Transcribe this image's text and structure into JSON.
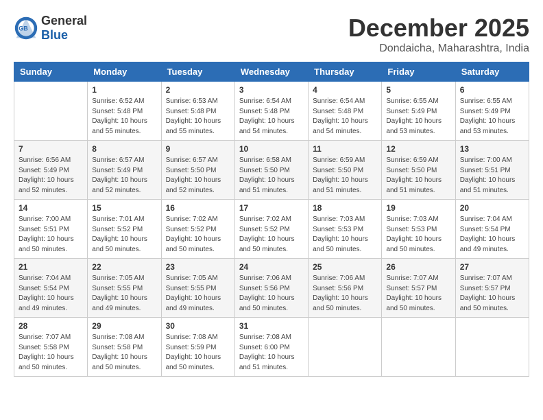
{
  "header": {
    "logo_general": "General",
    "logo_blue": "Blue",
    "month_title": "December 2025",
    "location": "Dondaicha, Maharashtra, India"
  },
  "days_of_week": [
    "Sunday",
    "Monday",
    "Tuesday",
    "Wednesday",
    "Thursday",
    "Friday",
    "Saturday"
  ],
  "weeks": [
    [
      {
        "day": null
      },
      {
        "day": 1,
        "sunrise": "6:52 AM",
        "sunset": "5:48 PM",
        "daylight": "10 hours and 55 minutes."
      },
      {
        "day": 2,
        "sunrise": "6:53 AM",
        "sunset": "5:48 PM",
        "daylight": "10 hours and 55 minutes."
      },
      {
        "day": 3,
        "sunrise": "6:54 AM",
        "sunset": "5:48 PM",
        "daylight": "10 hours and 54 minutes."
      },
      {
        "day": 4,
        "sunrise": "6:54 AM",
        "sunset": "5:48 PM",
        "daylight": "10 hours and 54 minutes."
      },
      {
        "day": 5,
        "sunrise": "6:55 AM",
        "sunset": "5:49 PM",
        "daylight": "10 hours and 53 minutes."
      },
      {
        "day": 6,
        "sunrise": "6:55 AM",
        "sunset": "5:49 PM",
        "daylight": "10 hours and 53 minutes."
      }
    ],
    [
      {
        "day": 7,
        "sunrise": "6:56 AM",
        "sunset": "5:49 PM",
        "daylight": "10 hours and 52 minutes."
      },
      {
        "day": 8,
        "sunrise": "6:57 AM",
        "sunset": "5:49 PM",
        "daylight": "10 hours and 52 minutes."
      },
      {
        "day": 9,
        "sunrise": "6:57 AM",
        "sunset": "5:50 PM",
        "daylight": "10 hours and 52 minutes."
      },
      {
        "day": 10,
        "sunrise": "6:58 AM",
        "sunset": "5:50 PM",
        "daylight": "10 hours and 51 minutes."
      },
      {
        "day": 11,
        "sunrise": "6:59 AM",
        "sunset": "5:50 PM",
        "daylight": "10 hours and 51 minutes."
      },
      {
        "day": 12,
        "sunrise": "6:59 AM",
        "sunset": "5:50 PM",
        "daylight": "10 hours and 51 minutes."
      },
      {
        "day": 13,
        "sunrise": "7:00 AM",
        "sunset": "5:51 PM",
        "daylight": "10 hours and 51 minutes."
      }
    ],
    [
      {
        "day": 14,
        "sunrise": "7:00 AM",
        "sunset": "5:51 PM",
        "daylight": "10 hours and 50 minutes."
      },
      {
        "day": 15,
        "sunrise": "7:01 AM",
        "sunset": "5:52 PM",
        "daylight": "10 hours and 50 minutes."
      },
      {
        "day": 16,
        "sunrise": "7:02 AM",
        "sunset": "5:52 PM",
        "daylight": "10 hours and 50 minutes."
      },
      {
        "day": 17,
        "sunrise": "7:02 AM",
        "sunset": "5:52 PM",
        "daylight": "10 hours and 50 minutes."
      },
      {
        "day": 18,
        "sunrise": "7:03 AM",
        "sunset": "5:53 PM",
        "daylight": "10 hours and 50 minutes."
      },
      {
        "day": 19,
        "sunrise": "7:03 AM",
        "sunset": "5:53 PM",
        "daylight": "10 hours and 50 minutes."
      },
      {
        "day": 20,
        "sunrise": "7:04 AM",
        "sunset": "5:54 PM",
        "daylight": "10 hours and 49 minutes."
      }
    ],
    [
      {
        "day": 21,
        "sunrise": "7:04 AM",
        "sunset": "5:54 PM",
        "daylight": "10 hours and 49 minutes."
      },
      {
        "day": 22,
        "sunrise": "7:05 AM",
        "sunset": "5:55 PM",
        "daylight": "10 hours and 49 minutes."
      },
      {
        "day": 23,
        "sunrise": "7:05 AM",
        "sunset": "5:55 PM",
        "daylight": "10 hours and 49 minutes."
      },
      {
        "day": 24,
        "sunrise": "7:06 AM",
        "sunset": "5:56 PM",
        "daylight": "10 hours and 50 minutes."
      },
      {
        "day": 25,
        "sunrise": "7:06 AM",
        "sunset": "5:56 PM",
        "daylight": "10 hours and 50 minutes."
      },
      {
        "day": 26,
        "sunrise": "7:07 AM",
        "sunset": "5:57 PM",
        "daylight": "10 hours and 50 minutes."
      },
      {
        "day": 27,
        "sunrise": "7:07 AM",
        "sunset": "5:57 PM",
        "daylight": "10 hours and 50 minutes."
      }
    ],
    [
      {
        "day": 28,
        "sunrise": "7:07 AM",
        "sunset": "5:58 PM",
        "daylight": "10 hours and 50 minutes."
      },
      {
        "day": 29,
        "sunrise": "7:08 AM",
        "sunset": "5:58 PM",
        "daylight": "10 hours and 50 minutes."
      },
      {
        "day": 30,
        "sunrise": "7:08 AM",
        "sunset": "5:59 PM",
        "daylight": "10 hours and 50 minutes."
      },
      {
        "day": 31,
        "sunrise": "7:08 AM",
        "sunset": "6:00 PM",
        "daylight": "10 hours and 51 minutes."
      },
      {
        "day": null
      },
      {
        "day": null
      },
      {
        "day": null
      }
    ]
  ]
}
